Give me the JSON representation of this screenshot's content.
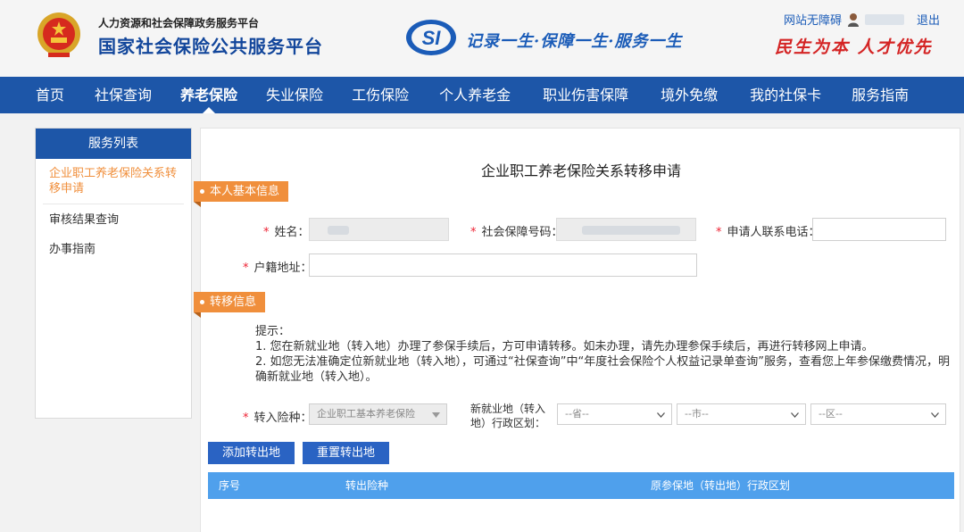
{
  "header": {
    "org_line1": "人力资源和社会保障政务服务平台",
    "org_line2": "国家社会保险公共服务平台",
    "si_logo_text": "SI",
    "motto": "记录一生·保障一生·服务一生",
    "slogan": "民生为本 人才优先",
    "accessibility_link": "网站无障碍",
    "logout_link": "退出"
  },
  "nav": {
    "items": [
      "首页",
      "社保查询",
      "养老保险",
      "失业保险",
      "工伤保险",
      "个人养老金",
      "职业伤害保障",
      "境外免缴",
      "我的社保卡",
      "服务指南"
    ],
    "active_index": 2
  },
  "sidebar": {
    "title": "服务列表",
    "items": [
      "企业职工养老保险关系转移申请",
      "审核结果查询",
      "办事指南"
    ],
    "active_index": 0
  },
  "form": {
    "title": "企业职工养老保险关系转移申请",
    "section1": "本人基本信息",
    "name_label": "姓名：",
    "ssn_label": "社会保障号码：",
    "phone_label": "申请人联系电话：",
    "address_label": "户籍地址：",
    "section2": "转移信息",
    "tips_title": "提示：",
    "tip1": "1. 您在新就业地（转入地）办理了参保手续后，方可申请转移。如未办理，请先办理参保手续后，再进行转移网上申请。",
    "tip2": "2. 如您无法准确定位新就业地（转入地），可通过“社保查询”中“年度社会保险个人权益记录单查询”服务，查看您上年参保缴费情况，明确新就业地（转入地）。",
    "insurance_label": "转入险种：",
    "insurance_value": "企业职工基本养老保险",
    "region_label_line1": "新就业地（转入",
    "region_label_line2": "地）行政区划：",
    "province_placeholder": "--省--",
    "city_placeholder": "--市--",
    "district_placeholder": "--区--",
    "add_button": "添加转出地",
    "reset_button": "重置转出地"
  },
  "table": {
    "columns": [
      "序号",
      "转出险种",
      "原参保地（转出地）行政区划"
    ]
  },
  "colors": {
    "brand_blue": "#1d56a8",
    "accent_orange": "#f08f3c",
    "table_header": "#4fa0ec",
    "button_blue": "#2a63c3"
  }
}
